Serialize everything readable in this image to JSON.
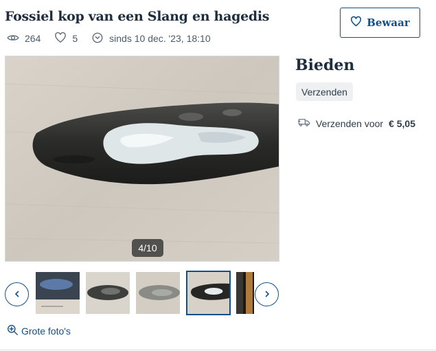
{
  "listing": {
    "title": "Fossiel kop van een Slang en hagedis",
    "save_label": "Bewaar",
    "views": "264",
    "favorites": "5",
    "posted": "sinds 10 dec. '23, 18:10"
  },
  "gallery": {
    "counter": "4/10",
    "current_index": 4,
    "total": 10,
    "big_photos_label": "Grote foto's"
  },
  "offer": {
    "heading": "Bieden",
    "delivery_chip": "Verzenden",
    "shipping_text": "Verzenden voor",
    "shipping_price": "€ 5,05"
  },
  "icons": {
    "views": "eye-icon",
    "favorites": "heart-icon",
    "posted": "clock-icon",
    "save": "heart-icon",
    "shipping": "truck-icon",
    "zoom": "zoom-in-icon",
    "prev": "chevron-left-icon",
    "next": "chevron-right-icon"
  },
  "colors": {
    "accent": "#0f4f8a",
    "text": "#2d3c4d",
    "chip_bg": "#eef0f2"
  }
}
